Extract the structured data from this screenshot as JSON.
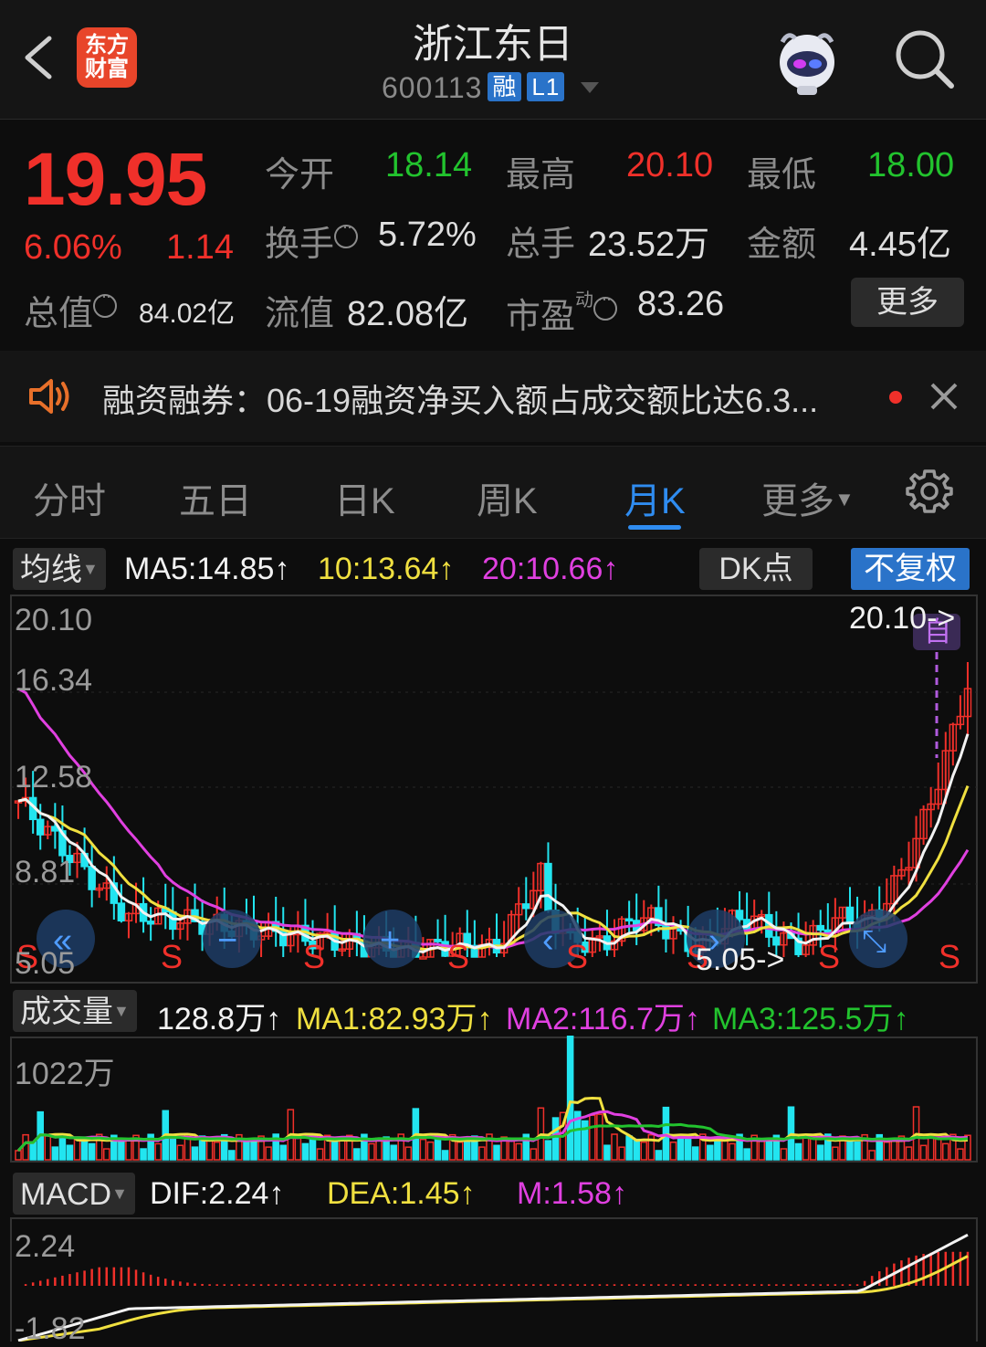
{
  "header": {
    "logo_text_1": "东方",
    "logo_text_2": "财富",
    "title": "浙江东日",
    "code": "600113",
    "tag_margin": "融",
    "tag_level": "L1"
  },
  "quote": {
    "price": "19.95",
    "change_pct": "6.06%",
    "change_abs": "1.14",
    "open_label": "今开",
    "open_value": "18.14",
    "high_label": "最高",
    "high_value": "20.10",
    "low_label": "最低",
    "low_value": "18.00",
    "turnover_label": "换手",
    "turnover_value": "5.72%",
    "volume_label": "总手",
    "volume_value": "23.52万",
    "amount_label": "金额",
    "amount_value": "4.45亿",
    "mktcap_label": "总值",
    "mktcap_value": "84.02亿",
    "float_label": "流值",
    "float_value": "82.08亿",
    "pe_label": "市盈",
    "pe_sup": "动",
    "pe_value": "83.26",
    "more_label": "更多"
  },
  "notice": {
    "text": "融资融券：06-19融资净买入额占成交额比达6.3..."
  },
  "tabs": [
    "分时",
    "五日",
    "日K",
    "周K",
    "月K",
    "更多"
  ],
  "active_tab": "月K",
  "kline": {
    "ma_dropdown": "均线",
    "ma5": "MA5:14.85",
    "ma10": "10:13.64",
    "ma20": "20:10.66",
    "dk_label": "DK点",
    "adjust_label": "不复权",
    "axis": [
      "20.10",
      "16.34",
      "12.58",
      "8.81",
      "5.05"
    ],
    "max_marker": "20.10->",
    "min_marker": "5.05->",
    "signal_sell": "S",
    "signal_buy_mark": "自"
  },
  "volume": {
    "dropdown": "成交量",
    "current": "128.8万",
    "ma1": "MA1:82.93万",
    "ma2": "MA2:116.7万",
    "ma3": "MA3:125.5万",
    "axis_top": "1022万"
  },
  "macd": {
    "dropdown": "MACD",
    "dif": "DIF:2.24",
    "dea": "DEA:1.45",
    "m": "M:1.58",
    "axis_top": "2.24",
    "axis_bottom": "-1.82"
  },
  "colors": {
    "up": "#f0302a",
    "down": "#22e5f0",
    "accent": "#2f8cf0",
    "ma5": "#f2f2f2",
    "ma10": "#f0e040",
    "ma20": "#e040e0"
  }
}
